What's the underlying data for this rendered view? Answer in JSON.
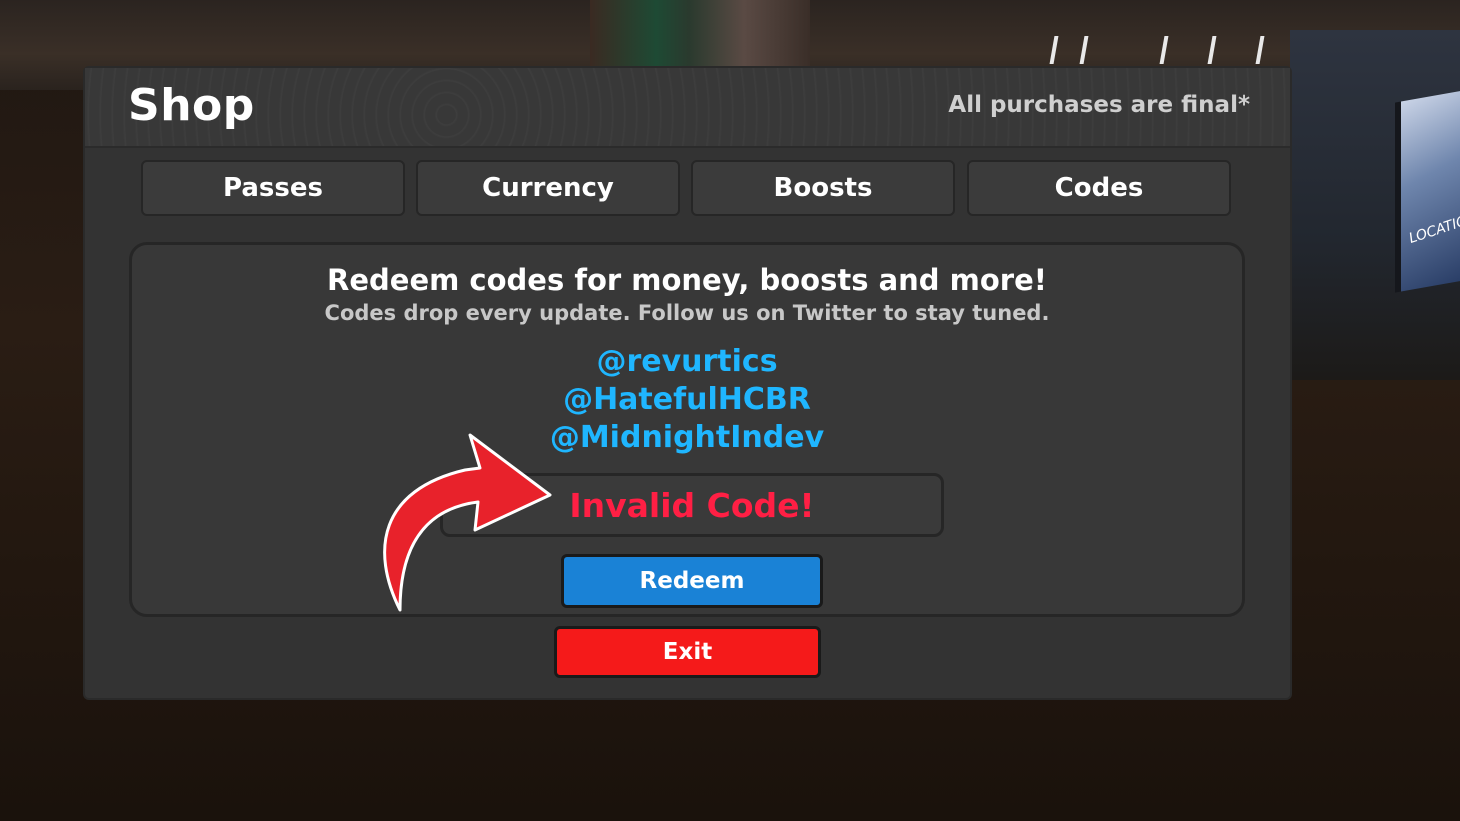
{
  "shop": {
    "title": "Shop",
    "notice": "All purchases are final*"
  },
  "tabs": [
    {
      "label": "Passes"
    },
    {
      "label": "Currency"
    },
    {
      "label": "Boosts"
    },
    {
      "label": "Codes"
    }
  ],
  "codes_panel": {
    "heading": "Redeem codes for money, boosts and more!",
    "subheading": "Codes drop every update. Follow us on Twitter to stay tuned.",
    "handles": [
      "@revurtics",
      "@HatefulHCBR",
      "@MidnightIndev"
    ],
    "code_field_value": "Invalid Code!",
    "redeem_label": "Redeem"
  },
  "exit_label": "Exit",
  "background": {
    "sign_text": "LOCATIO"
  },
  "colors": {
    "handle": "#1fb6ff",
    "error": "#ff1f44",
    "redeem": "#1a82d6",
    "exit": "#f51a1a",
    "annotation_arrow": "#e8222b"
  },
  "annotation": {
    "icon": "curved-arrow-icon"
  }
}
